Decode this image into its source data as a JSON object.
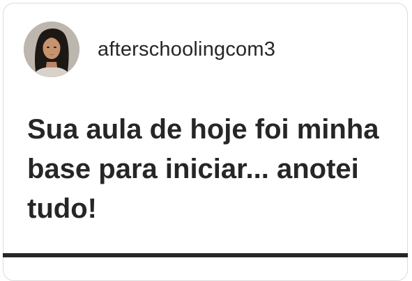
{
  "post": {
    "username": "afterschoolingcom3",
    "avatar_icon": "profile-photo",
    "message": "Sua aula de hoje foi minha base para iniciar... anotei tudo!"
  },
  "colors": {
    "text": "#262626",
    "border": "#dcdcdc",
    "background": "#ffffff"
  }
}
